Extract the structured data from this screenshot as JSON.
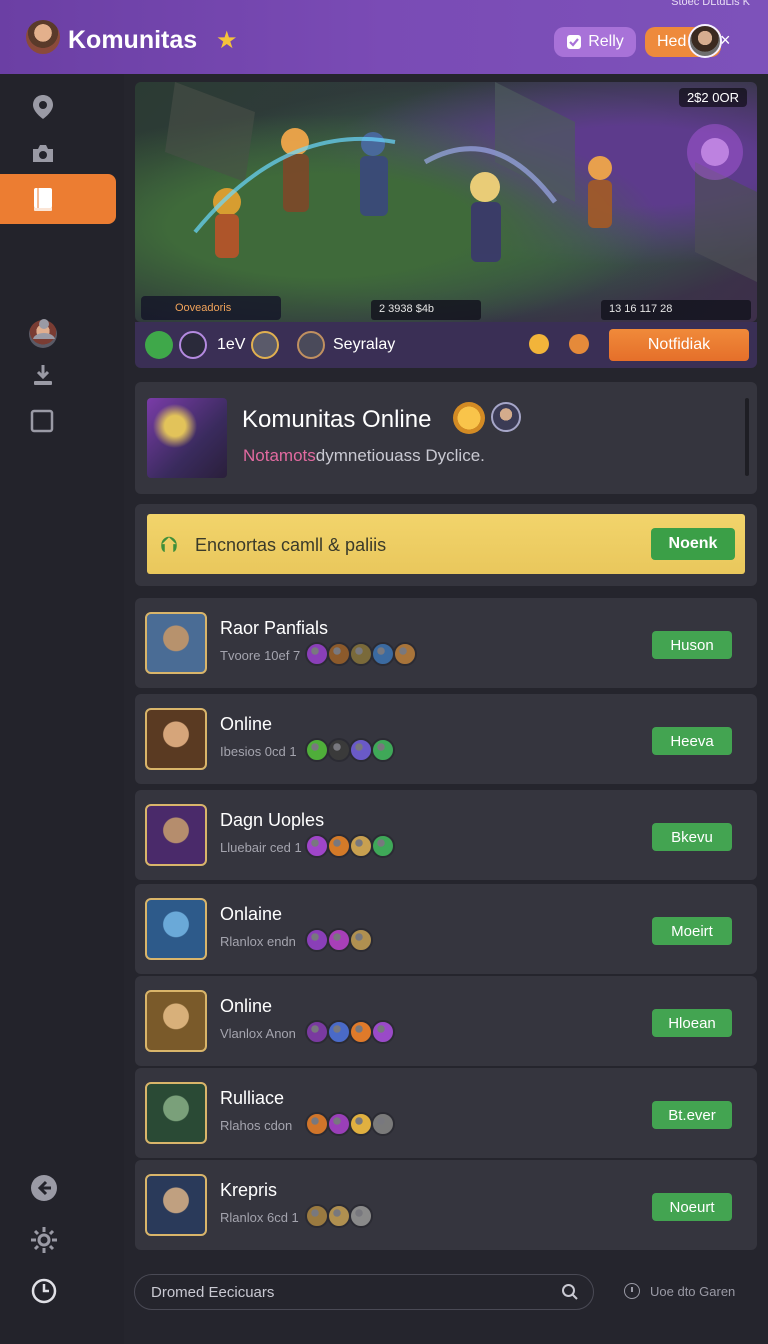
{
  "header": {
    "title": "Komunitas",
    "star_icon": "star-icon",
    "top_right_text": "Stoec DLtdLis K",
    "reply_label": "Relly",
    "hed_label": "Hed",
    "close_glyph": "×",
    "colors": {
      "bar": "#7a4bb5",
      "reply": "#a872d8",
      "hed": "#ee8a3c"
    }
  },
  "sidebar": {
    "items": [
      {
        "icon": "map-pin-icon"
      },
      {
        "icon": "camera-icon"
      },
      {
        "icon": "book-icon",
        "active": true
      },
      {
        "icon": "avatar"
      },
      {
        "icon": "people-icon"
      },
      {
        "icon": "download-icon"
      },
      {
        "icon": "square-icon"
      }
    ],
    "bottom": [
      "back-icon",
      "settings-icon",
      "clock-icon"
    ],
    "accent": "#ec7d32"
  },
  "banner": {
    "hud_top_right": "2$2 0OR",
    "hud_bottom_left": "Ooveadoris",
    "hud_bottom_mid": "2   3938   $4b",
    "hud_bottom_right": "13   16   117   28"
  },
  "gamebar": {
    "level_text": "1eV",
    "player_name": "Seyralay",
    "notify_label": "Notfidiak"
  },
  "community_card": {
    "title": "Komunitas Online",
    "subtitle_highlight": "Notamots",
    "subtitle_rest": "dymnetiouass Dyclice."
  },
  "invite": {
    "text": "Encnortas camll & paliis",
    "button": "Noenk",
    "colors": {
      "bg": "#f2d46b",
      "button": "#3b9f47"
    }
  },
  "players": [
    {
      "name": "Raor Panfials",
      "sub": "Tvoore 10ef 7",
      "button": "Huson",
      "avatar_colors": [
        "#4a6c95",
        "#b7926d"
      ],
      "icons": [
        "#8a3fb8",
        "#8c5a2b",
        "#7a6a3a",
        "#3b6aa0",
        "#a8743a"
      ]
    },
    {
      "name": "Online",
      "sub": "Ibesios 0cd 1",
      "button": "Heeva",
      "avatar_colors": [
        "#5a3a22",
        "#d6a57a"
      ],
      "icons": [
        "#4fae3a",
        "#3a3a3a",
        "#6a5ac8",
        "#3fa858"
      ]
    },
    {
      "name": "Dagn Uoples",
      "sub": "Lluebair ced 1",
      "button": "Bkevu",
      "avatar_colors": [
        "#4a2a6a",
        "#b58d6d"
      ],
      "icons": [
        "#9f45c9",
        "#d47a28",
        "#c8a050",
        "#3fa858"
      ]
    },
    {
      "name": "Onlaine",
      "sub": "Rlanlox endn",
      "button": "Moeirt",
      "avatar_colors": [
        "#2d5a8a",
        "#6aa9d8"
      ],
      "icons": [
        "#8a3fb8",
        "#a83fb8",
        "#b09050"
      ]
    },
    {
      "name": "Online",
      "sub": "Vlanlox Anon",
      "button": "Hloean",
      "avatar_colors": [
        "#7a5a2a",
        "#d8b07a"
      ],
      "icons": [
        "#7a3aa0",
        "#4a6ac8",
        "#e07a2a",
        "#9a4ac8"
      ]
    },
    {
      "name": "Rulliace",
      "sub": "Rlahos cdon",
      "button": "Bt.ever",
      "avatar_colors": [
        "#2a4a35",
        "#7aa07a"
      ],
      "icons": [
        "#d0752a",
        "#9a3fb8",
        "#e0b040",
        "#7a7a7a"
      ]
    },
    {
      "name": "Krepris",
      "sub": "Rlanlox 6cd 1",
      "button": "Noeurt",
      "avatar_colors": [
        "#2a3a5a",
        "#c0a080"
      ],
      "icons": [
        "#9a7a40",
        "#b09050",
        "#8a8a8a"
      ]
    }
  ],
  "search": {
    "placeholder": "Dromed Eecicuars"
  },
  "footer": {
    "status": "Uoe dto Garen"
  }
}
